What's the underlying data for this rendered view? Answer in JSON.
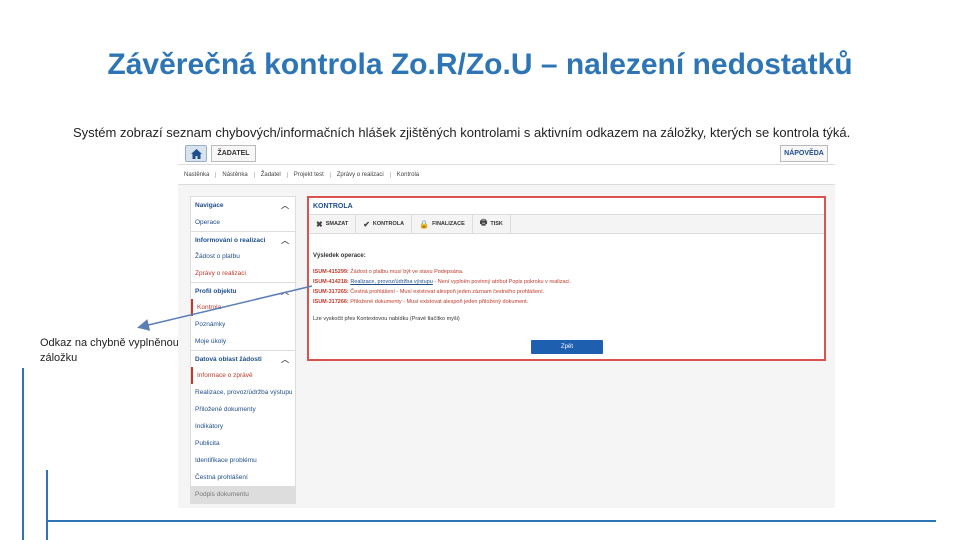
{
  "slide": {
    "title": "Závěrečná kontrola Zo.R/Zo.U – nalezení nedostatků",
    "description": "Systém zobrazí seznam chybových/informačních hlášek zjištěných kontrolami s aktivním odkazem na záložky, kterých se kontrola týká.",
    "callout": "Odkaz na chybně vyplněnou záložku",
    "accent_color": "#2e75b6",
    "highlight_color": "#d9534f"
  },
  "app": {
    "topbar": {
      "home_icon": "home-icon",
      "role_tab": "ŽADATEL",
      "help": "NÁPOVĚDA"
    },
    "breadcrumb": [
      "Nastěnka",
      "Nástěnka",
      "Žadatel",
      "Projekt test",
      "Zprávy o realizaci",
      "Kontrola"
    ],
    "sidebar": {
      "items": [
        {
          "label": "Navigace",
          "type": "header"
        },
        {
          "label": "Operace",
          "type": "sub"
        },
        {
          "label": "Informování o realizaci",
          "type": "header"
        },
        {
          "label": "Žádost o platbu",
          "type": "sub"
        },
        {
          "label": "Zprávy o realizaci",
          "type": "active"
        },
        {
          "label": "Profil objektu",
          "type": "header"
        },
        {
          "label": "Kontrola",
          "type": "selected"
        },
        {
          "label": "Poznámky",
          "type": "sub"
        },
        {
          "label": "Moje úkoly",
          "type": "sub"
        },
        {
          "label": "Datová oblast žádosti",
          "type": "header"
        },
        {
          "label": "Informace o zprávě",
          "type": "selected"
        },
        {
          "label": "Realizace, provoz/údržba výstupu",
          "type": "sub"
        },
        {
          "label": "Přiložené dokumenty",
          "type": "sub"
        },
        {
          "label": "Indikátory",
          "type": "sub"
        },
        {
          "label": "Publicita",
          "type": "sub"
        },
        {
          "label": "Identifikace problému",
          "type": "sub"
        },
        {
          "label": "Čestná prohlášení",
          "type": "sub"
        },
        {
          "label": "Podpis dokumentu",
          "type": "disabled"
        }
      ]
    },
    "control": {
      "title": "KONTROLA",
      "toolbar": [
        {
          "label": "SMAZAT",
          "icon": "close-icon"
        },
        {
          "label": "KONTROLA",
          "icon": "check-icon"
        },
        {
          "label": "FINALIZACE",
          "icon": "lock-icon"
        },
        {
          "label": "TISK",
          "icon": "print-icon"
        }
      ],
      "result_title": "Výsledek operace:",
      "results": [
        {
          "code": "ISUM-415299:",
          "link": "",
          "text": " Žádost o platbu musí být ve stavu Podepsána."
        },
        {
          "code": "ISUM-414218:",
          "link": "Realizace, provoz/údržba výstupu",
          "text": " - Není vyplněn povinný atribut Popis pokroku v realizaci."
        },
        {
          "code": "ISUM-317265:",
          "link": "",
          "text": " Čestná prohlášení - Musí existovat alespoň jeden záznam čestného prohlášení."
        },
        {
          "code": "ISUM-317266:",
          "link": "",
          "text": " Přiložené dokumenty - Musí existovat alespoň jeden přiložený dokument."
        }
      ],
      "note": "Lze vyskočit přes Kontextovou nabídku (Pravé tlačítko myši)",
      "back_button": "Zpět"
    }
  }
}
